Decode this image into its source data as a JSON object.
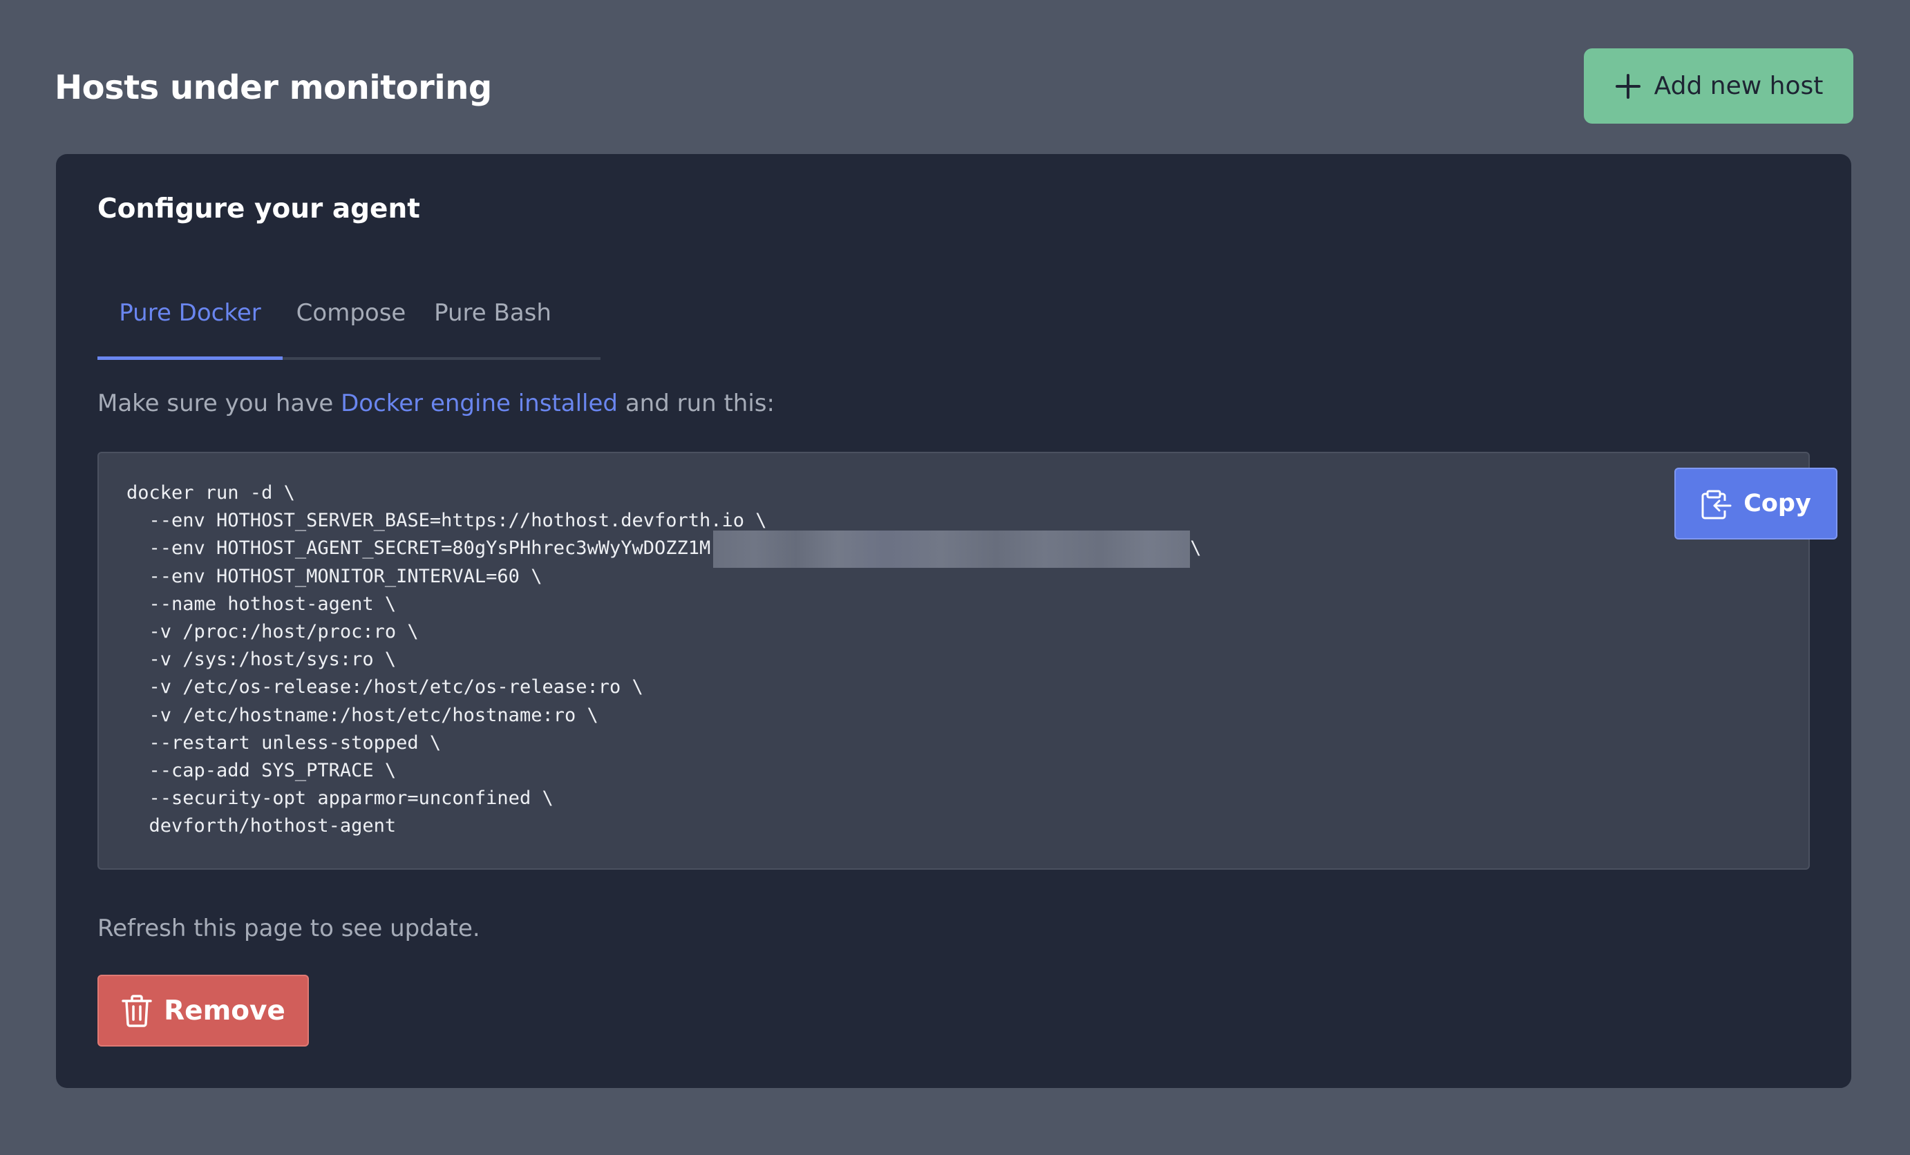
{
  "header": {
    "title": "Hosts under monitoring",
    "add_button_label": "Add new host"
  },
  "card": {
    "title": "Configure your agent",
    "tabs": [
      {
        "label": "Pure Docker",
        "active": true
      },
      {
        "label": "Compose",
        "active": false
      },
      {
        "label": "Pure Bash",
        "active": false
      }
    ],
    "intro_before": "Make sure you have ",
    "intro_link": "Docker engine installed",
    "intro_after": " and run this:",
    "code_lines": [
      "docker run -d \\",
      "  --env HOTHOST_SERVER_BASE=https://hothost.devforth.io \\",
      "  --env HOTHOST_AGENT_SECRET=80gYsPHhrec3wWyYwDOZZ1M",
      "  --env HOTHOST_MONITOR_INTERVAL=60 \\",
      "  --name hothost-agent \\",
      "  -v /proc:/host/proc:ro \\",
      "  -v /sys:/host/sys:ro \\",
      "  -v /etc/os-release:/host/etc/os-release:ro \\",
      "  -v /etc/hostname:/host/etc/hostname:ro \\",
      "  --restart unless-stopped \\",
      "  --cap-add SYS_PTRACE \\",
      "  --security-opt apparmor=unconfined \\",
      "  devforth/hothost-agent"
    ],
    "code_line3_tail": "\\",
    "copy_label": "Copy",
    "refresh_text": "Refresh this page to see update.",
    "remove_label": "Remove"
  },
  "colors": {
    "background": "#4f5665",
    "card": "#222838",
    "accent": "#6a86f0",
    "add_button": "#76c39a",
    "danger": "#d15e5a"
  },
  "icons": {
    "add": "plus-icon",
    "copy": "clipboard-copy-icon",
    "remove": "trash-icon"
  }
}
